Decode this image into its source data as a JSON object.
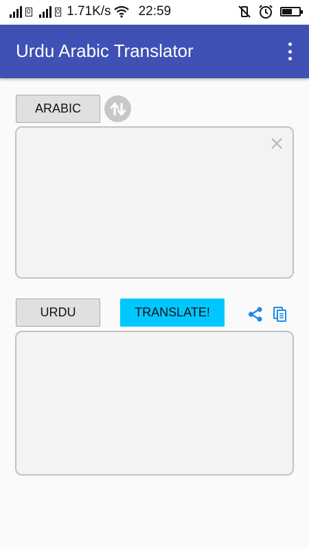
{
  "status_bar": {
    "net_speed": "1.71K/s",
    "time": "22:59",
    "sim1": "0",
    "sim2": "0"
  },
  "app_bar": {
    "title": "Urdu Arabic Translator",
    "menu_icon": "more-vert-icon"
  },
  "source": {
    "language_label": "ARABIC",
    "text": "",
    "clear_icon": "close-icon"
  },
  "swap": {
    "icon": "swap-vertical-icon"
  },
  "target": {
    "language_label": "URDU",
    "text": ""
  },
  "actions": {
    "translate_label": "TRANSLATE!",
    "share_icon": "share-icon",
    "copy_icon": "copy-icon"
  },
  "colors": {
    "app_bar": "#3f51b5",
    "translate_button": "#00c7ff",
    "icon_blue": "#1e88e5"
  }
}
